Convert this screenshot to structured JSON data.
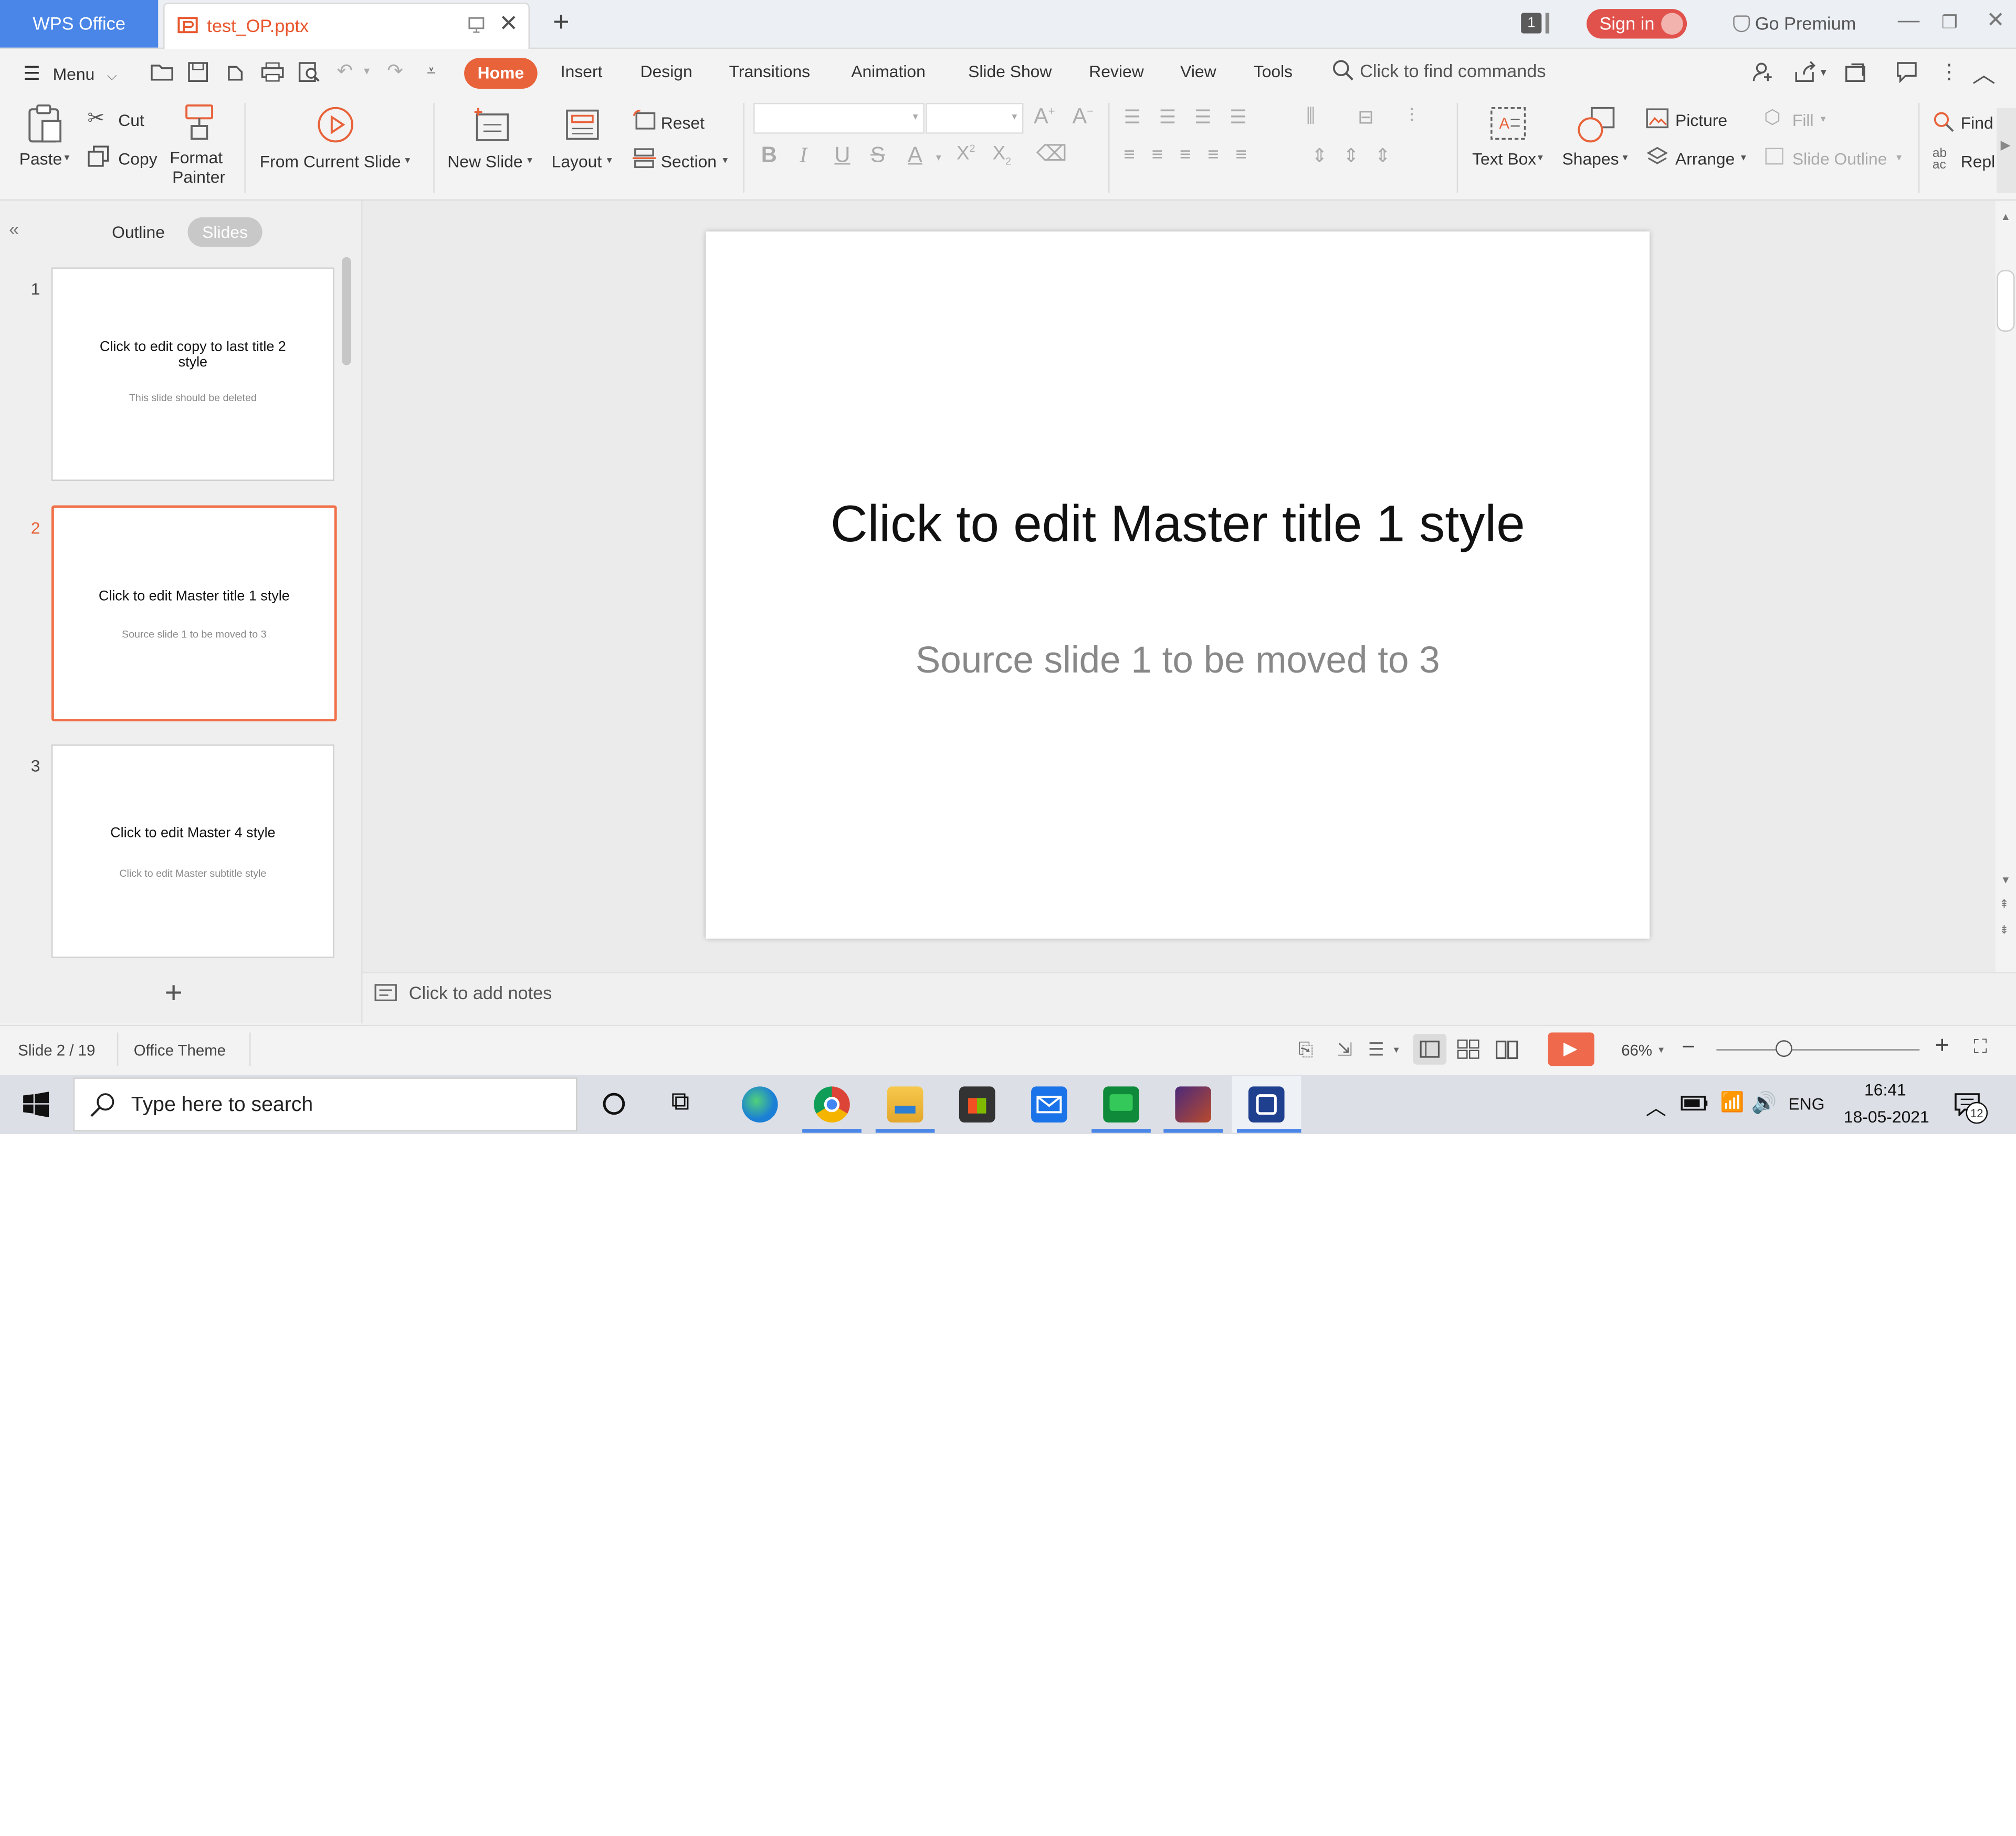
{
  "titlebar": {
    "app_tab": "WPS Office",
    "doc_tab": "test_OP.pptx",
    "count_badge": "1",
    "sign_in": "Sign in",
    "premium": "Go Premium"
  },
  "menu": {
    "menu_label": "Menu",
    "tabs": [
      "Home",
      "Insert",
      "Design",
      "Transitions",
      "Animation",
      "Slide Show",
      "Review",
      "View",
      "Tools"
    ],
    "search_placeholder": "Click to find commands"
  },
  "ribbon": {
    "paste": "Paste",
    "cut": "Cut",
    "copy": "Copy",
    "format_painter_1": "Format",
    "format_painter_2": "Painter",
    "from_current_slide": "From Current Slide",
    "new_slide": "New Slide",
    "layout": "Layout",
    "reset": "Reset",
    "section": "Section",
    "text_box": "Text Box",
    "shapes": "Shapes",
    "picture": "Picture",
    "arrange": "Arrange",
    "fill": "Fill",
    "slide_outline": "Slide Outline",
    "find": "Find",
    "replace": "Repl"
  },
  "panel": {
    "outline_tab": "Outline",
    "slides_tab": "Slides"
  },
  "slides": [
    {
      "num": "1",
      "title_l1": "Click to edit copy to last title 2",
      "title_l2": "style",
      "subtitle": "This slide should be deleted"
    },
    {
      "num": "2",
      "title_l1": "Click to edit Master title 1 style",
      "subtitle": "Source slide 1 to be moved to 3"
    },
    {
      "num": "3",
      "title_l1": "Click to edit Master  4 style",
      "subtitle": "Click to edit Master subtitle style"
    }
  ],
  "current_slide": {
    "title": "Click to edit Master title 1 style",
    "subtitle": "Source slide 1 to be moved to 3"
  },
  "notes_placeholder": "Click to add notes",
  "status": {
    "slide_indicator": "Slide 2 / 19",
    "theme": "Office Theme",
    "zoom": "66%",
    "zoom_fraction": 0.33
  },
  "taskbar": {
    "search_placeholder": "Type here to search",
    "language": "ENG",
    "time": "16:41",
    "date": "18-05-2021",
    "notification_count": "12"
  },
  "colors": {
    "accent": "#e8623a",
    "wps_blue": "#4a86e8",
    "selection": "#f0714a"
  }
}
